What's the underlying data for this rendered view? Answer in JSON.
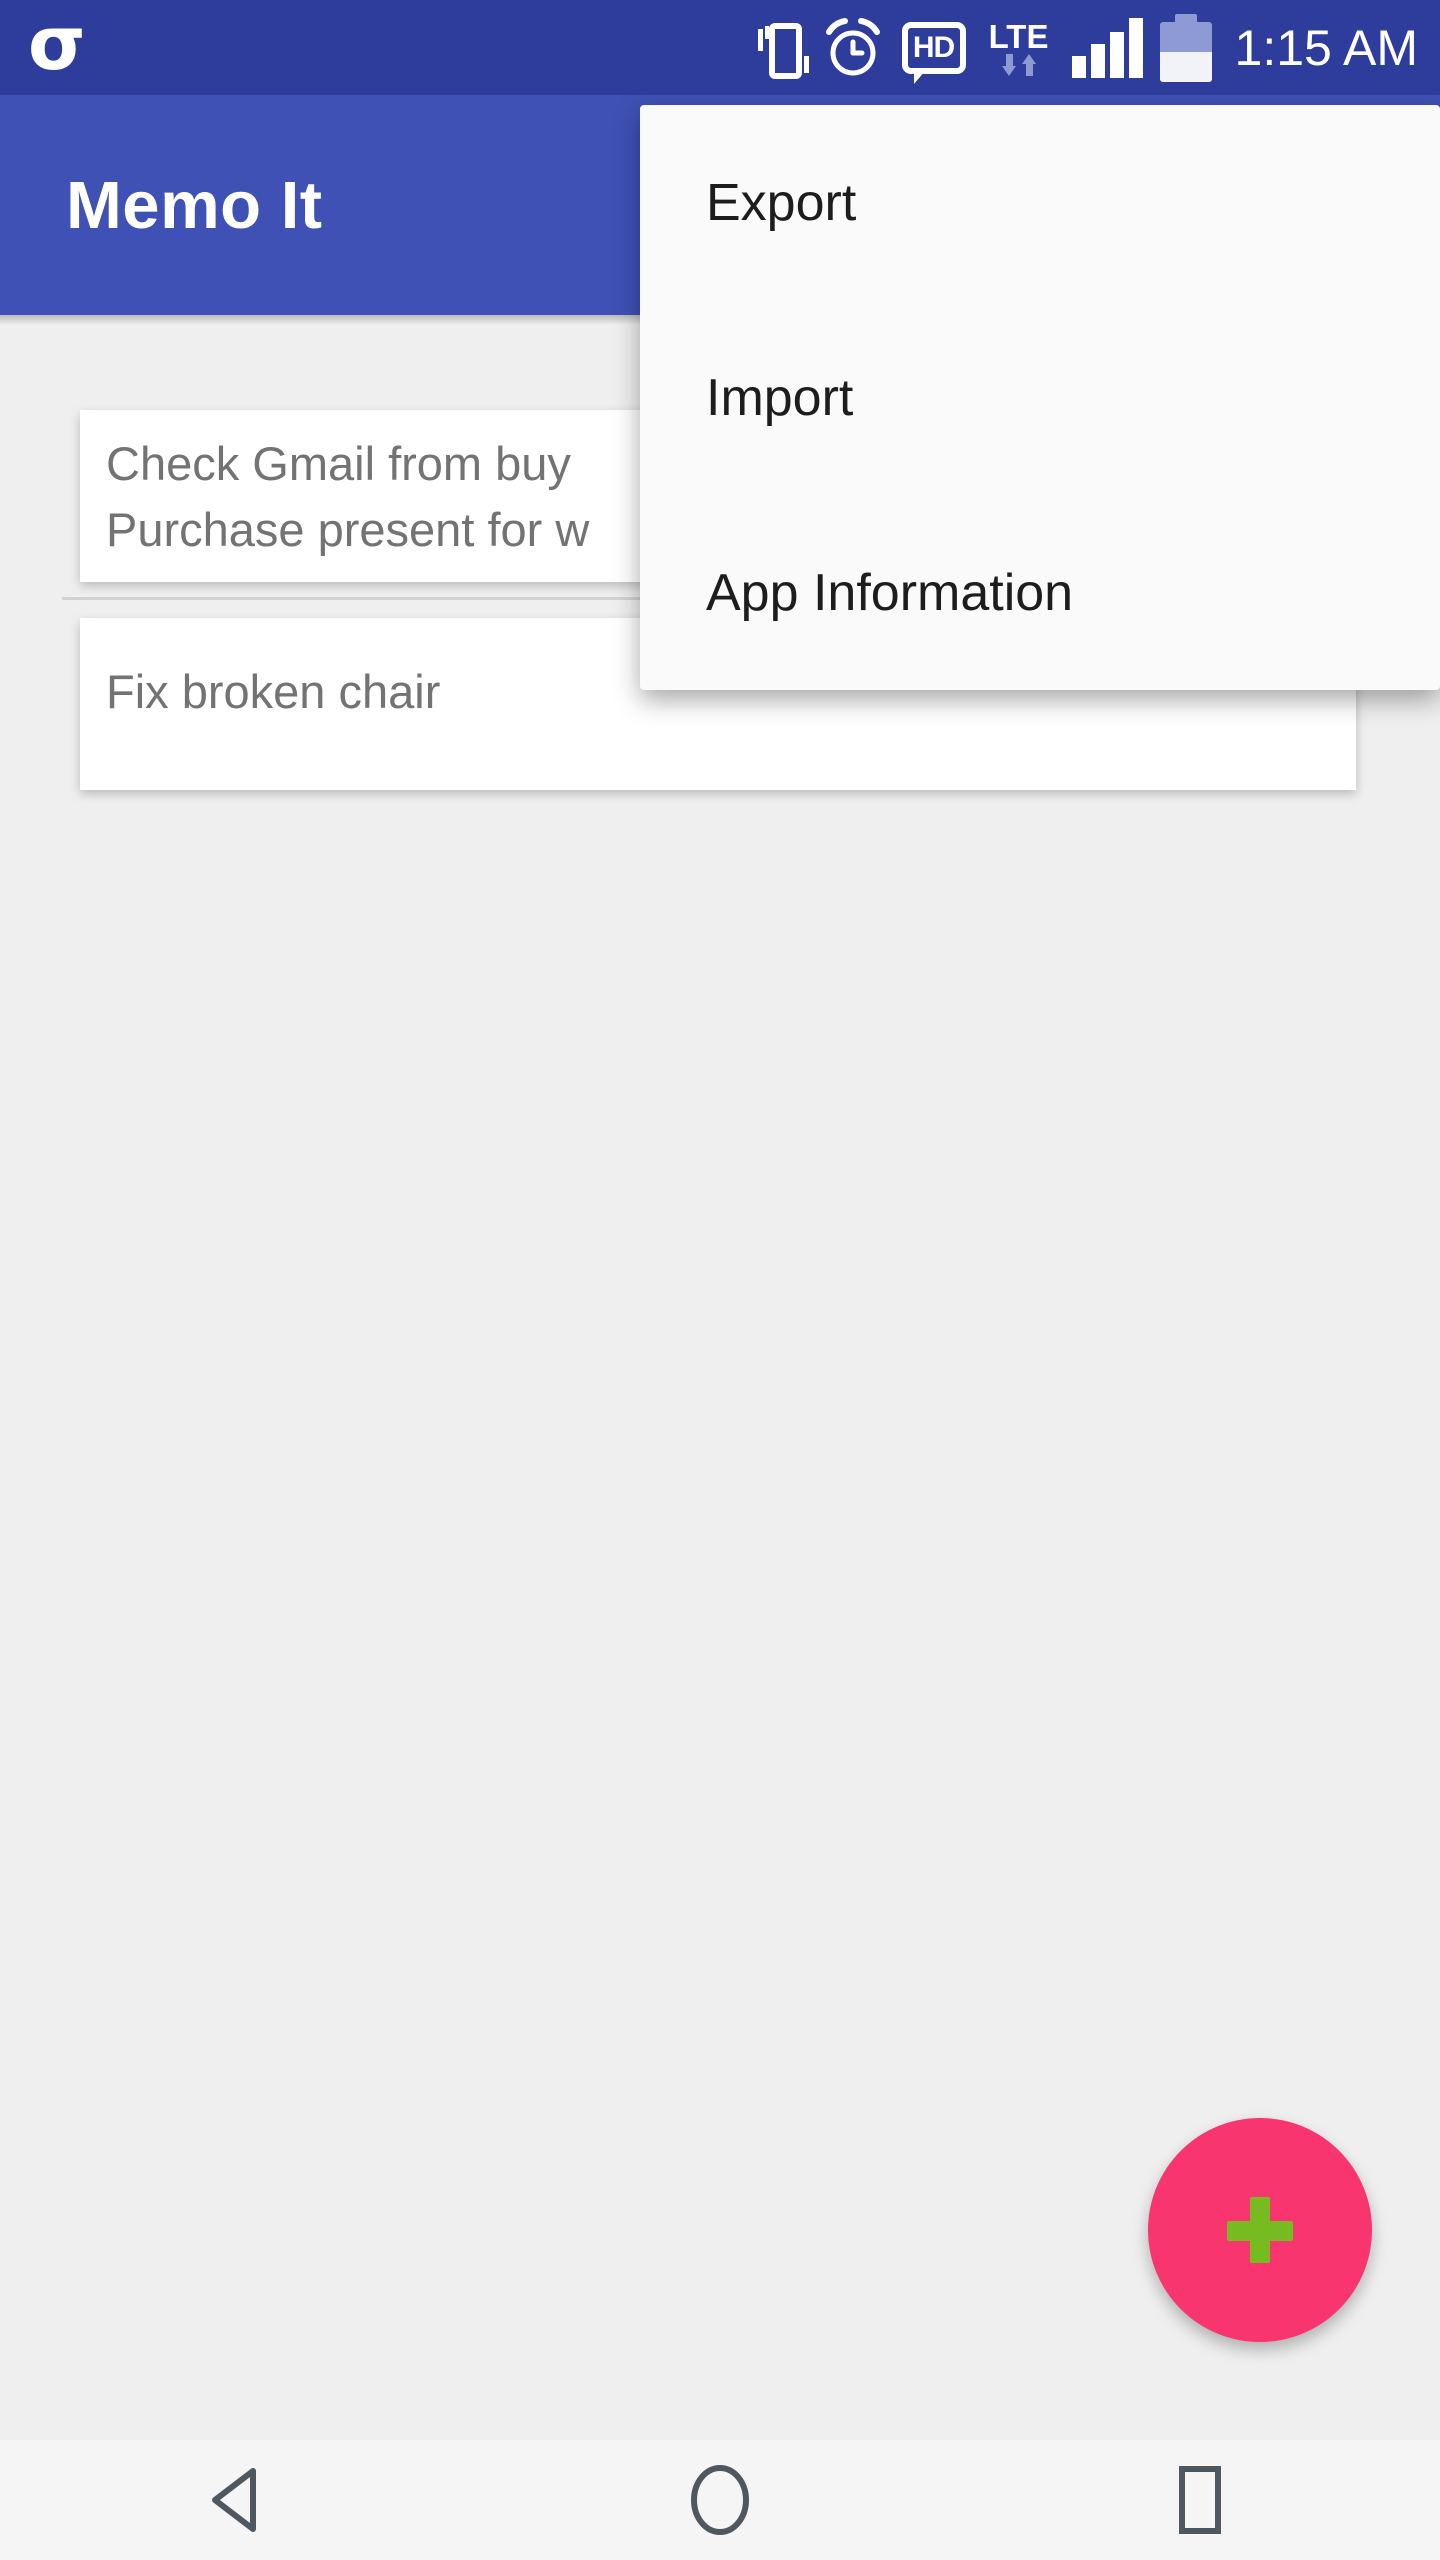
{
  "status_bar": {
    "notification_icon": "sigma-app-icon",
    "icons": [
      "vibrate-icon",
      "alarm-icon",
      "hd-voice-icon",
      "lte-icon",
      "signal-icon",
      "battery-icon"
    ],
    "hd_label": "HD",
    "lte_label": "LTE",
    "time": "1:15 AM",
    "battery_level_percent": 50,
    "signal_bars": 4,
    "background_color": "#2e3c9c"
  },
  "app_bar": {
    "title": "Memo It",
    "background_color": "#3f51b5",
    "text_color": "#ffffff"
  },
  "content": {
    "background_color": "#efefef",
    "memo_cards": [
      {
        "lines": [
          "Check Gmail from buy",
          "Purchase present for w"
        ]
      },
      {
        "lines": [
          "Fix broken chair"
        ]
      }
    ]
  },
  "fab": {
    "icon": "plus-icon",
    "background_color": "#f8356f",
    "icon_color": "#76bc21"
  },
  "overflow_menu": {
    "background_color": "#fafafa",
    "items": [
      {
        "label": "Export"
      },
      {
        "label": "Import"
      },
      {
        "label": "App Information"
      }
    ]
  },
  "nav_bar": {
    "background_color": "#f5f5f5",
    "icon_color": "#50585f",
    "buttons": [
      {
        "name": "back-button",
        "icon": "back-triangle-icon"
      },
      {
        "name": "home-button",
        "icon": "home-circle-icon"
      },
      {
        "name": "recents-button",
        "icon": "recents-square-icon"
      }
    ]
  }
}
